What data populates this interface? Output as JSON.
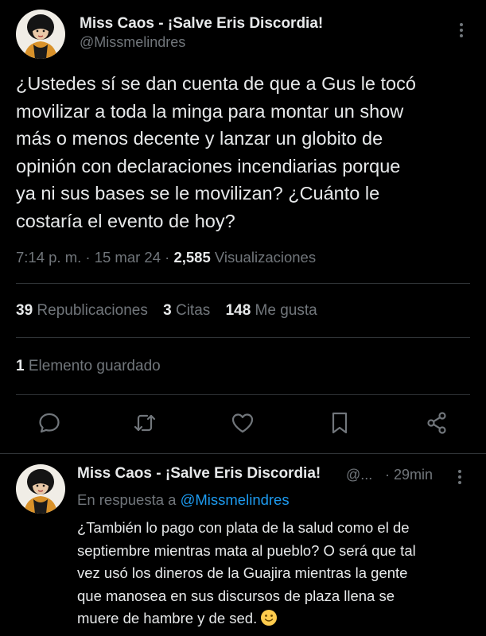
{
  "tweet": {
    "author_name": "Miss Caos - ¡Salve Eris Discordia!",
    "author_handle": "@Missmelindres",
    "text": "¿Ustedes sí se dan cuenta de que a Gus le tocó\nmovilizar a toda la minga para montar un show\nmás o menos decente y lanzar un globito de\nopinión con declaraciones incendiarias porque\nya ni sus bases se le movilizan? ¿Cuánto le\ncostaría el evento de hoy?",
    "time": "7:14 p. m.",
    "date": "15 mar 24",
    "views_count": "2,585",
    "views_label": "Visualizaciones",
    "separator": "·"
  },
  "stats": {
    "reposts_count": "39",
    "reposts_label": "Republicaciones",
    "quotes_count": "3",
    "quotes_label": "Citas",
    "likes_count": "148",
    "likes_label": "Me gusta",
    "saved_count": "1",
    "saved_label": "Elemento guardado"
  },
  "actions": [
    "reply-icon",
    "repost-icon",
    "like-icon",
    "bookmark-icon",
    "share-icon"
  ],
  "reply": {
    "author_name": "Miss Caos - ¡Salve Eris Discordia!",
    "author_handle_truncated": "@...",
    "time": "· 29min",
    "reply_prefix": "En respuesta a",
    "reply_to": "@Missmelindres",
    "text": "¿También lo pago con plata de la salud como el de\nseptiembre mientras mata al pueblo? O será que tal\nvez usó los dineros de la Guajira mientras la gente\nque manosea en sus discursos de plaza llena se\nmuere de hambre y de sed.",
    "emoji": "slightly-smiling-face-emoji"
  },
  "colors": {
    "background": "#000000",
    "text": "#e7e9ea",
    "secondary": "#71767b",
    "link": "#1d9bf0",
    "divider": "#2f3336"
  }
}
